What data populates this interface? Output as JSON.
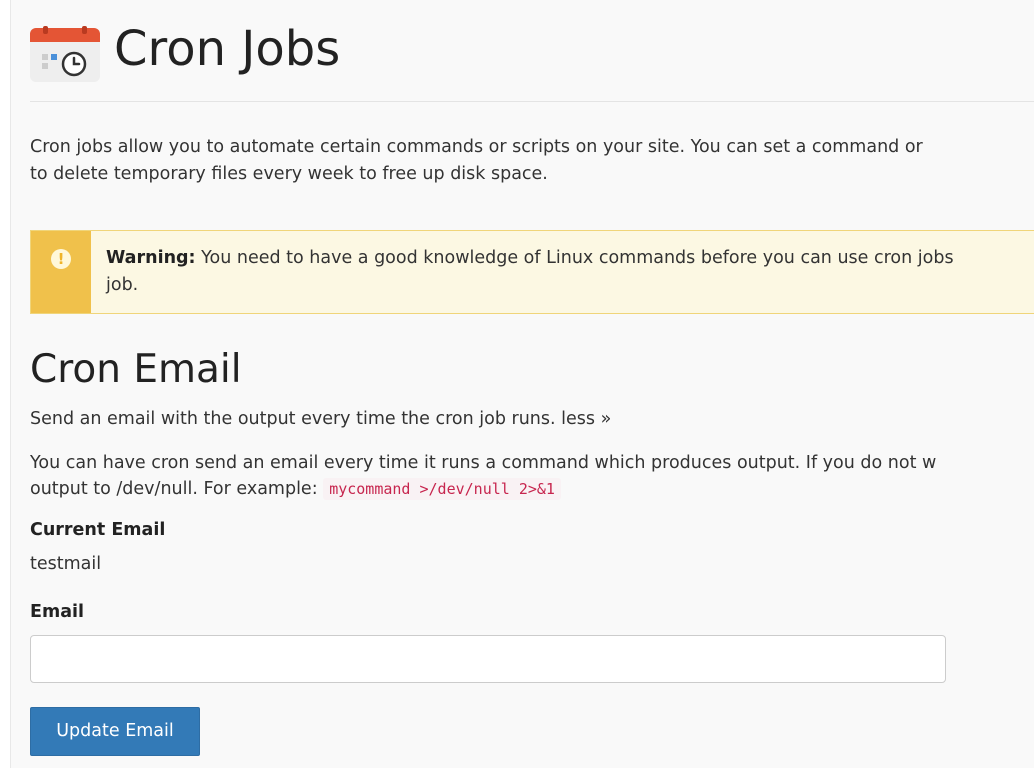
{
  "header": {
    "title": "Cron Jobs",
    "icon": "cron-calendar-clock-icon"
  },
  "intro": {
    "line1": "Cron jobs allow you to automate certain commands or scripts on your site. You can set a command or",
    "line2": "to delete temporary files every week to free up disk space."
  },
  "warning": {
    "icon": "exclamation-icon",
    "label": "Warning:",
    "line1": " You need to have a good knowledge of Linux commands before you can use cron jobs",
    "line2": "job."
  },
  "cron_email": {
    "title": "Cron Email",
    "summary": "Send an email with the output every time the cron job runs.",
    "toggle_link": "less »",
    "details_line1": "You can have cron send an email every time it runs a command which produces output. If you do not w",
    "details_line2": "output to /dev/null. For example:",
    "example_code": "mycommand >/dev/null 2>&1",
    "current_email_label": "Current Email",
    "current_email_value": "testmail",
    "email_label": "Email",
    "email_value": "",
    "update_button": "Update Email"
  },
  "colors": {
    "primary_button": "#337ab7",
    "warning_accent": "#f0c14b",
    "warning_bg": "#fcf8e3",
    "code_text": "#c7254e",
    "icon_red": "#d9472b"
  }
}
